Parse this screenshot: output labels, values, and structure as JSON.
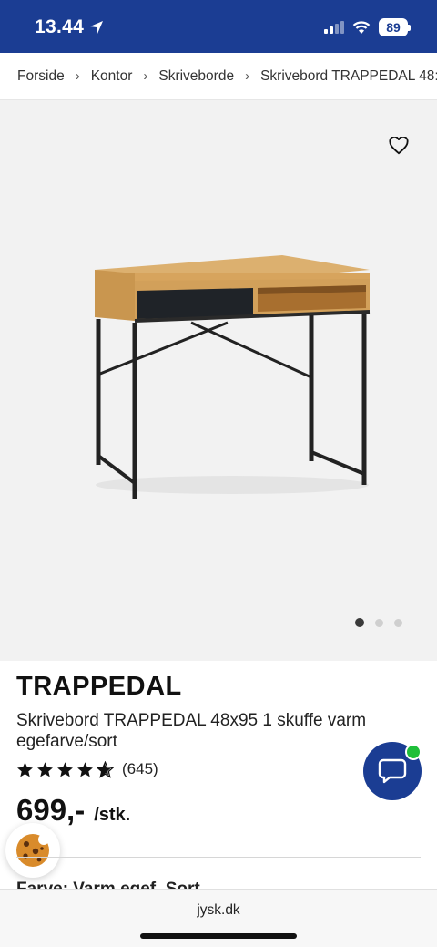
{
  "status_bar": {
    "time": "13.44",
    "battery": "89",
    "background": "#1b3d93"
  },
  "breadcrumb": {
    "items": [
      "Forside",
      "Kontor",
      "Skriveborde",
      "Skrivebord TRAPPEDAL 48:"
    ],
    "separator": "›"
  },
  "gallery": {
    "image_icon": "desk-photo",
    "favorite_icon": "heart-icon",
    "slide_count": 3,
    "active_slide": 1
  },
  "product": {
    "brand": "TRAPPEDAL",
    "name": "Skrivebord TRAPPEDAL 48x95 1 skuffe varm egefarve/sort",
    "rating": 4.5,
    "review_count": "(645)",
    "price": "699,-",
    "unit": "/stk."
  },
  "chat": {
    "icon": "chat-bubble-icon",
    "color": "#1b3d93",
    "online_color": "#1fbf3a"
  },
  "cookie": {
    "icon": "cookie-icon"
  },
  "truncated_text": "Farve: Varm egef. Sort",
  "browser": {
    "url": "jysk.dk"
  }
}
